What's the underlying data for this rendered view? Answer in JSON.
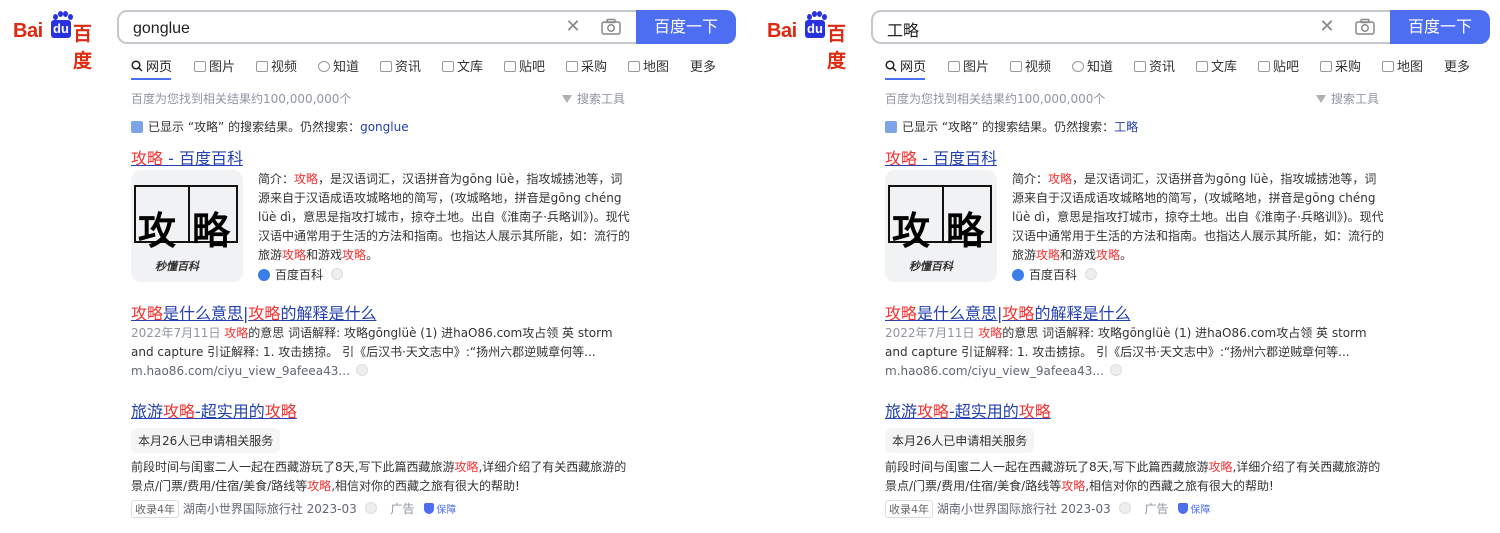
{
  "panels": [
    {
      "logo": {
        "bai": "Bai",
        "du": "du",
        "cn": "百度"
      },
      "search": {
        "query": "gonglue",
        "button": "百度一下"
      },
      "tabs": [
        "网页",
        "图片",
        "视频",
        "知道",
        "资讯",
        "文库",
        "贴吧",
        "采购",
        "地图",
        "更多"
      ],
      "result_count": "百度为您找到相关结果约100,000,000个",
      "search_tools": "搜索工具",
      "hint": {
        "prefix": "已显示 “攻略” 的搜索结果。仍然搜索：",
        "link": "gonglue"
      },
      "result1": {
        "title_red": "攻略",
        "title_rest": " - 百度百科",
        "thumb_chars": [
          "攻",
          "略"
        ],
        "thumb_caption": "秒懂百科",
        "abstract_a": "简介：",
        "abstract_b": "攻略",
        "abstract_c": "，是汉语词汇，汉语拼音为gōng lüè，指攻城掳池等，词源来自于汉语成语攻城略地的简写，(攻城略地，拼音是gōng chéng lüè dì，意思是指攻打城市，掠夺土地。出自《淮南子·兵略训》)。现代汉语中通常用于生活的方法和指南。也指达人展示其所能，如：流行的旅游",
        "abstract_d": "攻略",
        "abstract_e": "和游戏",
        "abstract_f": "攻略",
        "abstract_g": "。",
        "source": "百度百科"
      },
      "result2": {
        "title_red1": "攻略",
        "title_mid": "是什么意思|",
        "title_red2": "攻略",
        "title_end": "的解释是什么",
        "date": "2022年7月11日",
        "text_red": "攻略",
        "text_rest": "的意思 词语解释: 攻略gōnglüè (1) 进haO86.com攻占领 英 storm and capture 引证解释: 1. 攻击掳掠。 引《后汉书·天文志中》:“扬州六郡逆贼章何等...",
        "url": "m.hao86.com/ciyu_view_9afeea43..."
      },
      "result3": {
        "title_a": "旅游",
        "title_red1": "攻略",
        "title_b": "-超实用的",
        "title_red2": "攻略",
        "service": "本月26人已申请相关服务",
        "text_a": "前段时间与闺蜜二人一起在西藏游玩了8天,写下此篇西藏旅游",
        "text_red1": "攻略",
        "text_b": ",详细介绍了有关西藏旅游的景点/门票/费用/住宿/美食/路线等",
        "text_red2": "攻略",
        "text_c": ",相信对你的西藏之旅有很大的帮助!",
        "badge": "收录4年",
        "company": "湖南小世界国际旅行社 2023-03",
        "ad": "广告",
        "guarantee": "保障"
      }
    },
    {
      "logo": {
        "bai": "Bai",
        "du": "du",
        "cn": "百度"
      },
      "search": {
        "query": "工略",
        "button": "百度一下"
      },
      "tabs": [
        "网页",
        "图片",
        "视频",
        "知道",
        "资讯",
        "文库",
        "贴吧",
        "采购",
        "地图",
        "更多"
      ],
      "result_count": "百度为您找到相关结果约100,000,000个",
      "search_tools": "搜索工具",
      "hint": {
        "prefix": "已显示 “攻略” 的搜索结果。仍然搜索：",
        "link": "工略"
      },
      "result1": {
        "title_red": "攻略",
        "title_rest": " - 百度百科",
        "thumb_chars": [
          "攻",
          "略"
        ],
        "thumb_caption": "秒懂百科",
        "abstract_a": "简介：",
        "abstract_b": "攻略",
        "abstract_c": "，是汉语词汇，汉语拼音为gōng lüè，指攻城掳池等，词源来自于汉语成语攻城略地的简写，(攻城略地，拼音是gōng chéng lüè dì，意思是指攻打城市，掠夺土地。出自《淮南子·兵略训》)。现代汉语中通常用于生活的方法和指南。也指达人展示其所能，如：流行的旅游",
        "abstract_d": "攻略",
        "abstract_e": "和游戏",
        "abstract_f": "攻略",
        "abstract_g": "。",
        "source": "百度百科"
      },
      "result2": {
        "title_red1": "攻略",
        "title_mid": "是什么意思|",
        "title_red2": "攻略",
        "title_end": "的解释是什么",
        "date": "2022年7月11日",
        "text_red": "攻略",
        "text_rest": "的意思 词语解释: 攻略gōnglüè (1) 进haO86.com攻占领 英 storm and capture 引证解释: 1. 攻击掳掠。 引《后汉书·天文志中》:“扬州六郡逆贼章何等...",
        "url": "m.hao86.com/ciyu_view_9afeea43..."
      },
      "result3": {
        "title_a": "旅游",
        "title_red1": "攻略",
        "title_b": "-超实用的",
        "title_red2": "攻略",
        "service": "本月26人已申请相关服务",
        "text_a": "前段时间与闺蜜二人一起在西藏游玩了8天,写下此篇西藏旅游",
        "text_red1": "攻略",
        "text_b": ",详细介绍了有关西藏旅游的景点/门票/费用/住宿/美食/路线等",
        "text_red2": "攻略",
        "text_c": ",相信对你的西藏之旅有很大的帮助!",
        "badge": "收录4年",
        "company": "湖南小世界国际旅行社 2023-03",
        "ad": "广告",
        "guarantee": "保障"
      }
    }
  ],
  "colors": {
    "brand_blue": "#4e6ef2",
    "link_blue": "#2440b3",
    "highlight_red": "#f73131",
    "logo_red": "#de2910"
  },
  "icons": [
    "search-icon",
    "clear-icon",
    "camera-icon",
    "filter-icon",
    "baike-icon",
    "shield-icon"
  ]
}
